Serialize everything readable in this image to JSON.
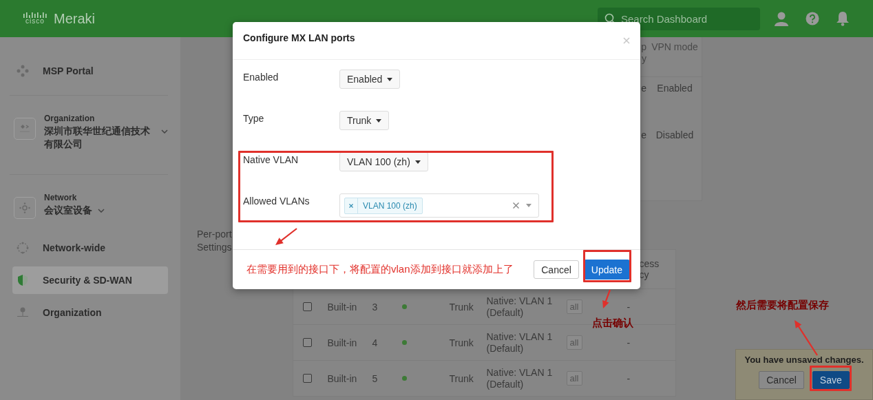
{
  "header": {
    "logo_mark": "cisco",
    "brand": "Meraki",
    "search": {
      "placeholder": "Search Dashboard"
    }
  },
  "sidebar": {
    "items": [
      {
        "kind": "link",
        "label": "MSP Portal",
        "selected": false
      },
      {
        "kind": "picker",
        "caption": "Organization",
        "label": "深圳市联华世纪通信技术有限公司",
        "selected": false
      },
      {
        "kind": "picker",
        "caption": "Network",
        "label": "会议室设备",
        "selected": false
      },
      {
        "kind": "link",
        "label": "Network-wide",
        "selected": false
      },
      {
        "kind": "link",
        "label": "Security & SD-WAN",
        "selected": true
      },
      {
        "kind": "link",
        "label": "Organization",
        "selected": false
      }
    ]
  },
  "vpn_table": {
    "columns": [
      "p y",
      "VPN mode"
    ],
    "rows": [
      [
        "e",
        "Enabled"
      ],
      [
        "e",
        "Disabled"
      ]
    ]
  },
  "per_port_label": "Per-port Settings",
  "ports_table": {
    "columns": [
      "cess cy"
    ],
    "rows": [
      {
        "checked": false,
        "source": "Built-in",
        "port": "3",
        "connected": true,
        "type": "Trunk",
        "vlan": "Native: VLAN 1 (Default)",
        "allowed": "all",
        "last": "-"
      },
      {
        "checked": false,
        "source": "Built-in",
        "port": "4",
        "connected": true,
        "type": "Trunk",
        "vlan": "Native: VLAN 1 (Default)",
        "allowed": "all",
        "last": "-"
      },
      {
        "checked": false,
        "source": "Built-in",
        "port": "5",
        "connected": true,
        "type": "Trunk",
        "vlan": "Native: VLAN 1 (Default)",
        "allowed": "all",
        "last": "-"
      }
    ]
  },
  "modal": {
    "title": "Configure MX LAN ports",
    "fields": [
      {
        "kind": "dropdown",
        "label": "Enabled",
        "value": "Enabled"
      },
      {
        "kind": "dropdown",
        "label": "Type",
        "value": "Trunk"
      },
      {
        "kind": "dropdown",
        "label": "Native VLAN",
        "value": "VLAN 100 (zh)"
      },
      {
        "kind": "multiselect",
        "label": "Allowed VLANs",
        "tags": [
          "VLAN 100 (zh)"
        ]
      }
    ],
    "note": "在需要用到的接口下，将配置的vlan添加到接口就添加上了",
    "buttons": [
      {
        "kind": "secondary",
        "label": "Cancel"
      },
      {
        "kind": "primary",
        "label": "Update"
      }
    ]
  },
  "unsaved_bar": {
    "message": "You have unsaved changes.",
    "buttons": [
      {
        "kind": "secondary",
        "label": "Cancel"
      },
      {
        "kind": "primary",
        "label": "Save"
      }
    ]
  },
  "annotations": [
    {
      "kind": "note",
      "text": "点击确认"
    },
    {
      "kind": "note",
      "text": "然后需要将配置保存"
    }
  ]
}
